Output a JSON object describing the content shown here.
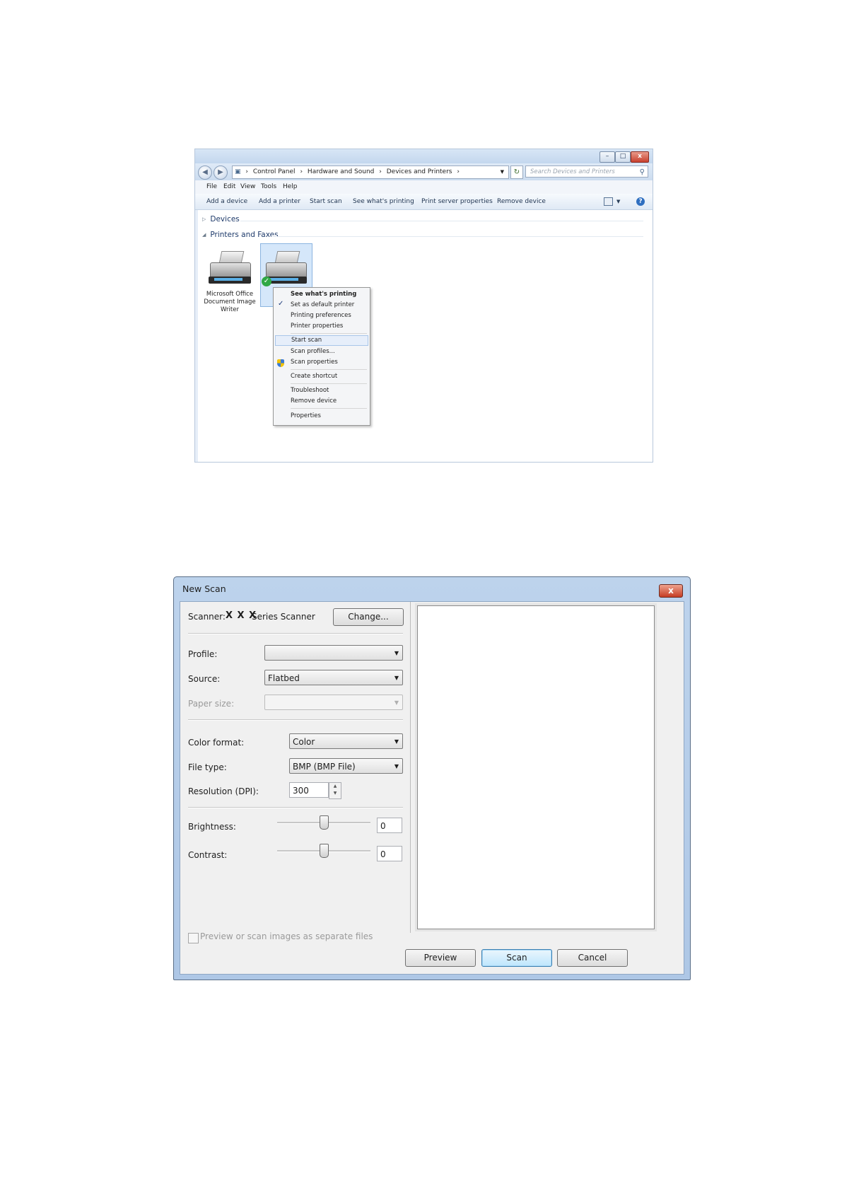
{
  "explorer": {
    "address": [
      "Control Panel",
      "Hardware and Sound",
      "Devices and Printers"
    ],
    "search_placeholder": "Search Devices and Printers",
    "menu": [
      "File",
      "Edit",
      "View",
      "Tools",
      "Help"
    ],
    "commands": [
      "Add a device",
      "Add a printer",
      "Start scan",
      "See what's printing",
      "Print server properties",
      "Remove device"
    ],
    "groups": {
      "devices": "Devices",
      "printers": "Printers and Faxes"
    },
    "printer1_label": [
      "Microsoft Office",
      "Document Image",
      "Writer"
    ],
    "context_menu": {
      "items": [
        "See what's printing",
        "Set as default printer",
        "Printing preferences",
        "Printer properties",
        "Start scan",
        "Scan profiles...",
        "Scan properties",
        "Create shortcut",
        "Troubleshoot",
        "Remove device",
        "Properties"
      ],
      "highlighted": "Start scan"
    }
  },
  "dialog": {
    "title": "New Scan",
    "scanner_label": "Scanner:",
    "scanner_name_mark": "X X X",
    "scanner_name": "Series Scanner",
    "change_button": "Change...",
    "profile_label": "Profile:",
    "profile_value": "",
    "source_label": "Source:",
    "source_value": "Flatbed",
    "paper_size_label": "Paper size:",
    "paper_size_value": "",
    "color_format_label": "Color format:",
    "color_format_value": "Color",
    "file_type_label": "File type:",
    "file_type_value": "BMP (BMP File)",
    "resolution_label": "Resolution (DPI):",
    "resolution_value": "300",
    "brightness_label": "Brightness:",
    "brightness_value": "0",
    "contrast_label": "Contrast:",
    "contrast_value": "0",
    "separate_files_label": "Preview or scan images as separate files",
    "preview_button": "Preview",
    "scan_button": "Scan",
    "cancel_button": "Cancel"
  }
}
